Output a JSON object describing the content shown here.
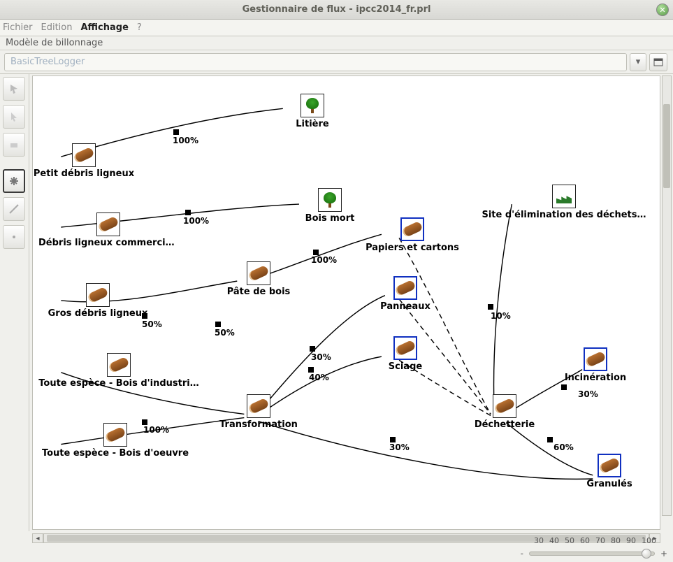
{
  "window": {
    "title": "Gestionnaire de flux - ipcc2014_fr.prl"
  },
  "menu": {
    "fichier": "Fichier",
    "edition": "Edition",
    "affichage": "Affichage",
    "help": "?"
  },
  "panel": {
    "label": "Modèle de billonnage",
    "combo_value": "BasicTreeLogger"
  },
  "nodes": {
    "litiere": "Litière",
    "petit_debris": "Petit débris ligneux",
    "bois_mort": "Bois mort",
    "debris_comm": "Débris ligneux commerciaux",
    "site_elim": "Site d'élimination des déchets…",
    "papiers": "Papiers et cartons",
    "gros_debris": "Gros débris ligneux",
    "pate": "Pâte de bois",
    "panneaux": "Panneaux",
    "industrie": "Toute espèce - Bois d'industri…",
    "sciage": "Sciage",
    "incineration": "Incinération",
    "transformation": "Transformation",
    "dechetterie": "Déchetterie",
    "oeuvre": "Toute espèce - Bois d'oeuvre",
    "granules": "Granulés"
  },
  "edges": {
    "p100a": "100%",
    "p100b": "100%",
    "p100c": "100%",
    "p100d": "100%",
    "p10": "10%",
    "p50a": "50%",
    "p50b": "50%",
    "p30a": "30%",
    "p30b": "30%",
    "p40": "40%",
    "p30c": "30%",
    "p60": "60%"
  },
  "zoom": {
    "minus": "-",
    "plus": "+",
    "ticks": [
      "30",
      "40",
      "50",
      "60",
      "70",
      "80",
      "90",
      "100"
    ]
  }
}
